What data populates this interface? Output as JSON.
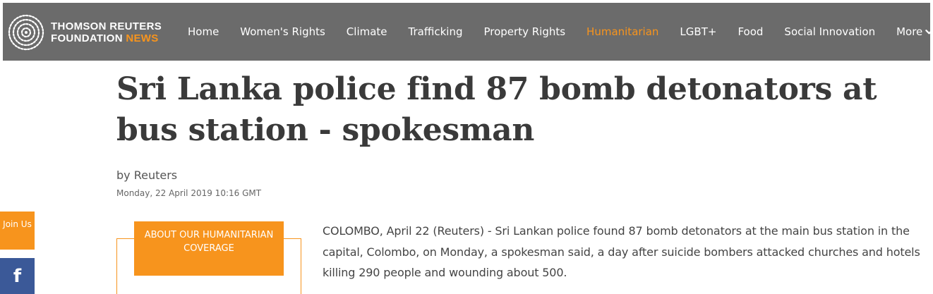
{
  "brand": {
    "line1": "THOMSON REUTERS",
    "line2_prefix": "FOUNDATION",
    "line2_accent": "NEWS",
    "accent_color": "#f7941d",
    "nav_bg": "#6b6b6b"
  },
  "nav": {
    "items": [
      {
        "label": "Home"
      },
      {
        "label": "Women's Rights"
      },
      {
        "label": "Climate"
      },
      {
        "label": "Trafficking"
      },
      {
        "label": "Property Rights"
      },
      {
        "label": "Humanitarian",
        "active": true
      },
      {
        "label": "LGBT+"
      },
      {
        "label": "Food"
      },
      {
        "label": "Social Innovation"
      }
    ],
    "more_label": "More",
    "more_icon": "chevron-down-icon"
  },
  "article": {
    "headline": "Sri Lanka police find 87 bomb detonators at bus station - spokesman",
    "byline": "by Reuters",
    "date": "Monday, 22 April 2019 10:16 GMT",
    "body": "COLOMBO, April 22 (Reuters) - Sri Lankan police found 87 bomb detonators at the main bus station in the capital, Colombo, on Monday, a spokesman said, a day after suicide bombers attacked churches and hotels killing 290 people and wounding about 500."
  },
  "sidebar": {
    "join_label": "Join Us",
    "facebook_icon": "facebook-icon",
    "facebook_glyph": "f",
    "facebook_color": "#3b5998"
  },
  "coverage": {
    "label": "ABOUT OUR HUMANITARIAN COVERAGE"
  }
}
